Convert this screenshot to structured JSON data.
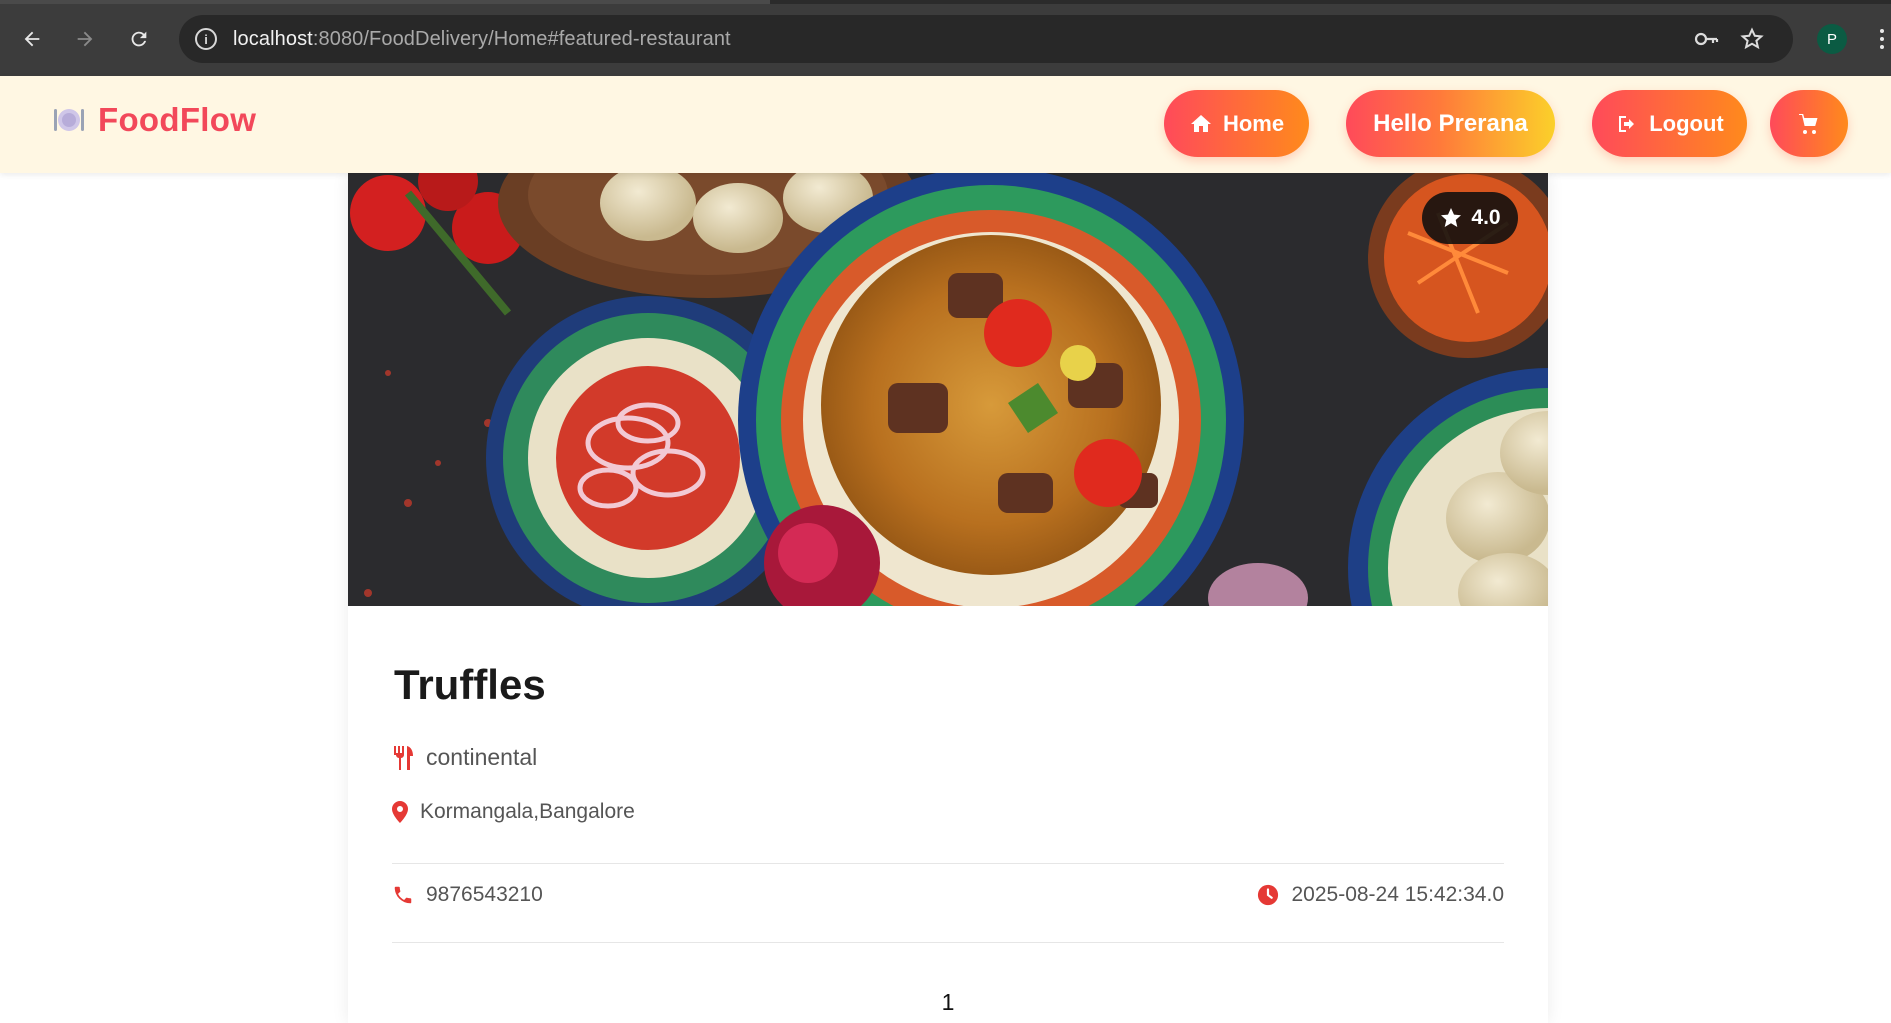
{
  "browser": {
    "url_host": "localhost",
    "url_rest": ":8080/FoodDelivery/Home#featured-restaurant",
    "profile_initial": "P"
  },
  "header": {
    "brand_name": "FoodFlow",
    "nav": {
      "home_label": "Home",
      "greeting_label": "Hello Prerana",
      "logout_label": "Logout"
    }
  },
  "restaurant": {
    "rating": "4.0",
    "name": "Truffles",
    "cuisine": "continental",
    "address": "Kormangala,Bangalore",
    "phone": "9876543210",
    "timestamp": "2025-08-24 15:42:34.0"
  },
  "pagination": {
    "current_page": "1"
  },
  "colors": {
    "brand": "#f2485a",
    "gradient_start": "#ff4a5a",
    "gradient_end": "#ff8a1c",
    "icon_red": "#e53935"
  }
}
